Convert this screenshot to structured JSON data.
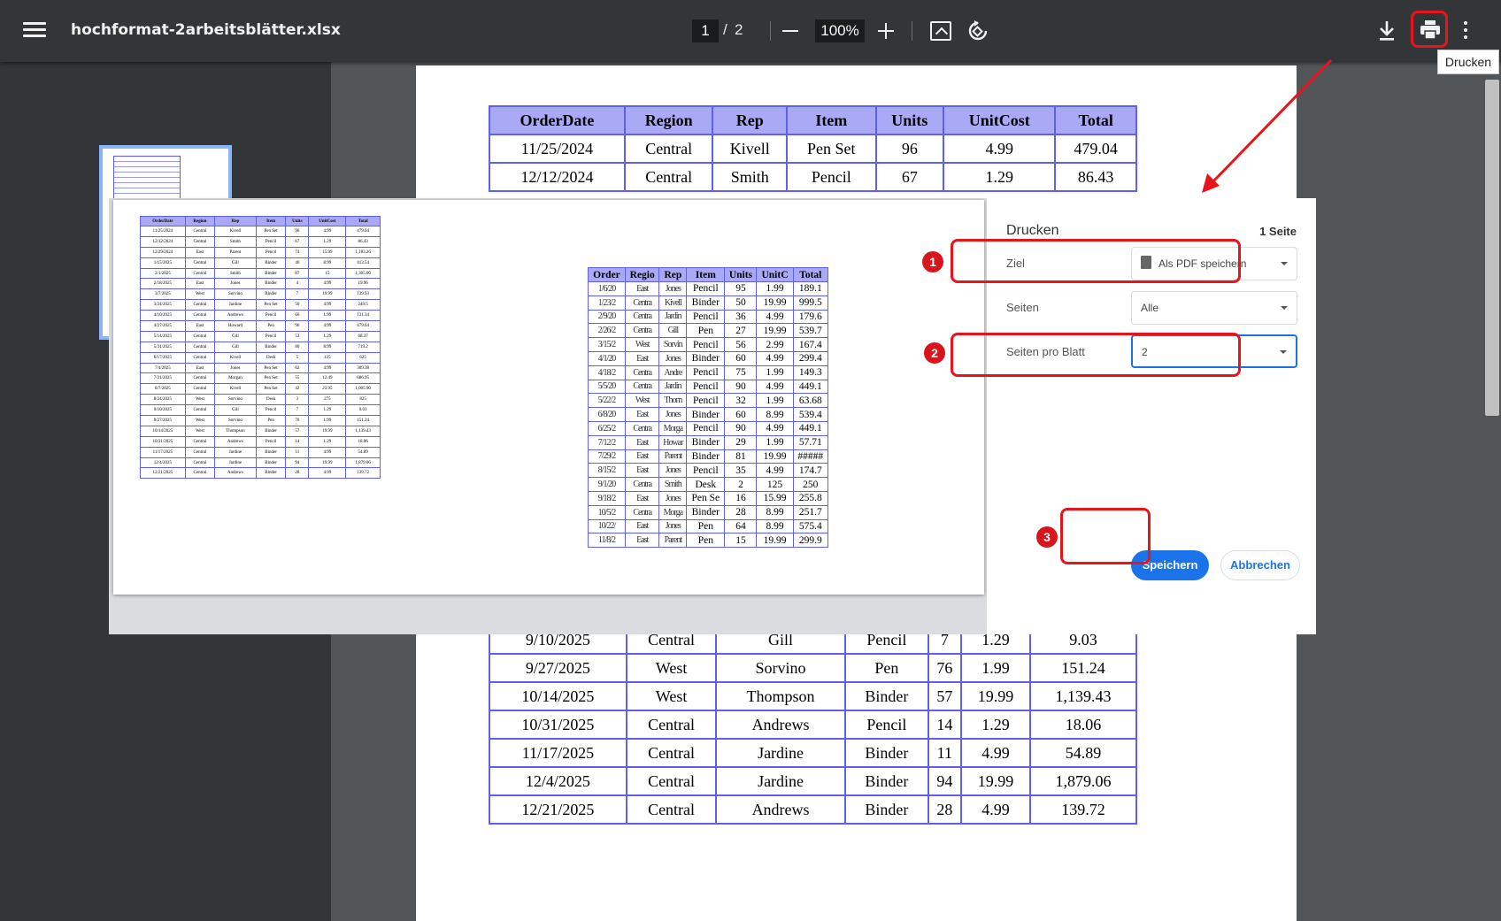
{
  "toolbar": {
    "title": "hochformat-2arbeitsblätter.xlsx",
    "page_current": "1",
    "page_separator": "/",
    "page_total": "2",
    "zoom": "100%",
    "tooltip": "Drucken"
  },
  "sheet": {
    "headers": [
      "OrderDate",
      "Region",
      "Rep",
      "Item",
      "Units",
      "UnitCost",
      "Total"
    ],
    "top_rows": [
      [
        "11/25/2024",
        "Central",
        "Kivell",
        "Pen Set",
        "96",
        "4.99",
        "479.04"
      ],
      [
        "12/12/2024",
        "Central",
        "Smith",
        "Pencil",
        "67",
        "1.29",
        "86.43"
      ]
    ],
    "partial_row": [
      "9/10/2025",
      "Central",
      "Gill",
      "Pencil",
      "7",
      "1.29",
      "9.03"
    ],
    "bottom_rows": [
      [
        "9/27/2025",
        "West",
        "Sorvino",
        "Pen",
        "76",
        "1.99",
        "151.24"
      ],
      [
        "10/14/2025",
        "West",
        "Thompson",
        "Binder",
        "57",
        "19.99",
        "1,139.43"
      ],
      [
        "10/31/2025",
        "Central",
        "Andrews",
        "Pencil",
        "14",
        "1.29",
        "18.06"
      ],
      [
        "11/17/2025",
        "Central",
        "Jardine",
        "Binder",
        "11",
        "4.99",
        "54.89"
      ],
      [
        "12/4/2025",
        "Central",
        "Jardine",
        "Binder",
        "94",
        "19.99",
        "1,879.06"
      ],
      [
        "12/21/2025",
        "Central",
        "Andrews",
        "Binder",
        "28",
        "4.99",
        "139.72"
      ]
    ]
  },
  "preview": {
    "left_headers": [
      "OrderDate",
      "Region",
      "Rep",
      "Item",
      "Units",
      "UnitCost",
      "Total"
    ],
    "left_rows": [
      [
        "11/25/2024",
        "Central",
        "Kivell",
        "Pen Set",
        "96",
        "4.99",
        "479.04"
      ],
      [
        "12/12/2024",
        "Central",
        "Smith",
        "Pencil",
        "67",
        "1.29",
        "86.43"
      ],
      [
        "12/29/2024",
        "East",
        "Parent",
        "Pencil",
        "74",
        "15.99",
        "1,183.26"
      ],
      [
        "1/15/2025",
        "Central",
        "Gill",
        "Binder",
        "46",
        "8.99",
        "413.54"
      ],
      [
        "2/1/2025",
        "Central",
        "Smith",
        "Binder",
        "87",
        "15",
        "1,305.00"
      ],
      [
        "2/18/2025",
        "East",
        "Jones",
        "Binder",
        "4",
        "4.99",
        "19.96"
      ],
      [
        "3/7/2025",
        "West",
        "Sorvino",
        "Binder",
        "7",
        "19.99",
        "139.93"
      ],
      [
        "3/24/2025",
        "Central",
        "Jardine",
        "Pen Set",
        "50",
        "4.99",
        "249.5"
      ],
      [
        "4/10/2025",
        "Central",
        "Andrews",
        "Pencil",
        "66",
        "1.99",
        "131.34"
      ],
      [
        "4/27/2025",
        "East",
        "Howard",
        "Pen",
        "96",
        "4.99",
        "479.04"
      ],
      [
        "5/14/2025",
        "Central",
        "Gill",
        "Pencil",
        "53",
        "1.29",
        "68.37"
      ],
      [
        "5/31/2025",
        "Central",
        "Gill",
        "Binder",
        "80",
        "8.99",
        "719.2"
      ],
      [
        "6/17/2025",
        "Central",
        "Kivell",
        "Desk",
        "5",
        "125",
        "625"
      ],
      [
        "7/4/2025",
        "East",
        "Jones",
        "Pen Set",
        "62",
        "4.99",
        "309.38"
      ],
      [
        "7/21/2025",
        "Central",
        "Morgan",
        "Pen Set",
        "55",
        "12.49",
        "686.95"
      ],
      [
        "8/7/2025",
        "Central",
        "Kivell",
        "Pen Set",
        "42",
        "23.95",
        "1,005.90"
      ],
      [
        "8/24/2025",
        "West",
        "Sorvino",
        "Desk",
        "3",
        "275",
        "825"
      ],
      [
        "9/10/2025",
        "Central",
        "Gill",
        "Pencil",
        "7",
        "1.29",
        "9.03"
      ],
      [
        "9/27/2025",
        "West",
        "Sorvino",
        "Pen",
        "76",
        "1.99",
        "151.24"
      ],
      [
        "10/14/2025",
        "West",
        "Thompson",
        "Binder",
        "57",
        "19.99",
        "1,139.43"
      ],
      [
        "10/31/2025",
        "Central",
        "Andrews",
        "Pencil",
        "14",
        "1.29",
        "18.06"
      ],
      [
        "11/17/2025",
        "Central",
        "Jardine",
        "Binder",
        "11",
        "4.99",
        "54.89"
      ],
      [
        "12/4/2025",
        "Central",
        "Jardine",
        "Binder",
        "94",
        "19.99",
        "1,879.06"
      ],
      [
        "12/21/2025",
        "Central",
        "Andrews",
        "Binder",
        "28",
        "4.99",
        "139.72"
      ]
    ],
    "right_headers": [
      "Order",
      "Regio",
      "Rep",
      "Item",
      "Units",
      "UnitC",
      "Total"
    ],
    "right_rows": [
      [
        "1/6/20",
        "East",
        "Jones",
        "Pencil",
        "95",
        "1.99",
        "189.1"
      ],
      [
        "1/23/2",
        "Centra",
        "Kivell",
        "Binder",
        "50",
        "19.99",
        "999.5"
      ],
      [
        "2/9/20",
        "Centra",
        "Jardin",
        "Pencil",
        "36",
        "4.99",
        "179.6"
      ],
      [
        "2/26/2",
        "Centra",
        "Gill",
        "Pen",
        "27",
        "19.99",
        "539.7"
      ],
      [
        "3/15/2",
        "West",
        "Sorvin",
        "Pencil",
        "56",
        "2.99",
        "167.4"
      ],
      [
        "4/1/20",
        "East",
        "Jones",
        "Binder",
        "60",
        "4.99",
        "299.4"
      ],
      [
        "4/18/2",
        "Centra",
        "Andre",
        "Pencil",
        "75",
        "1.99",
        "149.3"
      ],
      [
        "5/5/20",
        "Centra",
        "Jardin",
        "Pencil",
        "90",
        "4.99",
        "449.1"
      ],
      [
        "5/22/2",
        "West",
        "Thom",
        "Pencil",
        "32",
        "1.99",
        "63.68"
      ],
      [
        "6/8/20",
        "East",
        "Jones",
        "Binder",
        "60",
        "8.99",
        "539.4"
      ],
      [
        "6/25/2",
        "Centra",
        "Morga",
        "Pencil",
        "90",
        "4.99",
        "449.1"
      ],
      [
        "7/12/2",
        "East",
        "Howar",
        "Binder",
        "29",
        "1.99",
        "57.71"
      ],
      [
        "7/29/2",
        "East",
        "Parent",
        "Binder",
        "81",
        "19.99",
        "#####"
      ],
      [
        "8/15/2",
        "East",
        "Jones",
        "Pencil",
        "35",
        "4.99",
        "174.7"
      ],
      [
        "9/1/20",
        "Centra",
        "Smith",
        "Desk",
        "2",
        "125",
        "250"
      ],
      [
        "9/18/2",
        "East",
        "Jones",
        "Pen Se",
        "16",
        "15.99",
        "255.8"
      ],
      [
        "10/5/2",
        "Centra",
        "Morga",
        "Binder",
        "28",
        "8.99",
        "251.7"
      ],
      [
        "10/22/",
        "East",
        "Jones",
        "Pen",
        "64",
        "8.99",
        "575.4"
      ],
      [
        "11/8/2",
        "East",
        "Parent",
        "Pen",
        "15",
        "19.99",
        "299.9"
      ]
    ]
  },
  "dialog": {
    "title": "Drucken",
    "pages_count": "1 Seite",
    "destination_label": "Ziel",
    "destination_value": "Als PDF speichern",
    "pages_label": "Seiten",
    "pages_value": "Alle",
    "per_sheet_label": "Seiten pro Blatt",
    "per_sheet_value": "2",
    "save_label": "Speichern",
    "cancel_label": "Abbrechen"
  },
  "annotations": {
    "badge_1": "1",
    "badge_2": "2",
    "badge_3": "3",
    "highlight_color": "#e8141c"
  },
  "colors": {
    "toolbar_bg": "#323639",
    "viewer_bg": "#525659",
    "table_border": "#6060f0",
    "table_header": "#a9a9f5",
    "accent": "#1a73e8"
  }
}
